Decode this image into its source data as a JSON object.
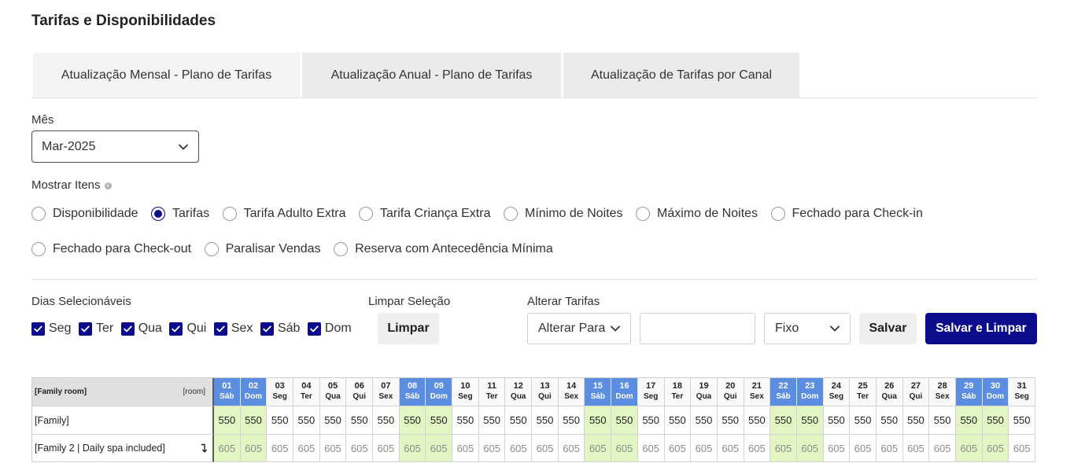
{
  "page_title": "Tarifas e Disponibilidades",
  "tabs": [
    {
      "label": "Atualização Mensal - Plano de Tarifas",
      "active": true
    },
    {
      "label": "Atualização Anual - Plano de Tarifas",
      "active": false
    },
    {
      "label": "Atualização de Tarifas por Canal",
      "active": false
    }
  ],
  "month": {
    "label": "Mês",
    "value": "Mar-2025"
  },
  "show_items": {
    "label": "Mostrar Itens",
    "info_icon": "info-icon",
    "options": [
      {
        "label": "Disponibilidade",
        "checked": false
      },
      {
        "label": "Tarifas",
        "checked": true
      },
      {
        "label": "Tarifa Adulto Extra",
        "checked": false
      },
      {
        "label": "Tarifa Criança Extra",
        "checked": false
      },
      {
        "label": "Mínimo de Noites",
        "checked": false
      },
      {
        "label": "Máximo de Noites",
        "checked": false
      },
      {
        "label": "Fechado para Check-in",
        "checked": false
      },
      {
        "label": "Fechado para Check-out",
        "checked": false
      },
      {
        "label": "Paralisar Vendas",
        "checked": false
      },
      {
        "label": "Reserva com Antecedência Mínima",
        "checked": false
      }
    ]
  },
  "selectable_days": {
    "label": "Dias Selecionáveis",
    "days": [
      {
        "label": "Seg",
        "checked": true
      },
      {
        "label": "Ter",
        "checked": true
      },
      {
        "label": "Qua",
        "checked": true
      },
      {
        "label": "Qui",
        "checked": true
      },
      {
        "label": "Sex",
        "checked": true
      },
      {
        "label": "Sáb",
        "checked": true
      },
      {
        "label": "Dom",
        "checked": true
      }
    ]
  },
  "clear_selection": {
    "label": "Limpar Seleção",
    "button": "Limpar"
  },
  "change_rates": {
    "label": "Alterar Tarifas",
    "mode": "Alterar Para",
    "amount": "",
    "type": "Fixo",
    "save": "Salvar",
    "save_and_clear": "Salvar e Limpar"
  },
  "rate_grid": {
    "room_type": "[Family room]",
    "room_type_tag": "[room]",
    "dates": [
      {
        "day": "01",
        "weekday": "Sáb"
      },
      {
        "day": "02",
        "weekday": "Dom"
      },
      {
        "day": "03",
        "weekday": "Seg"
      },
      {
        "day": "04",
        "weekday": "Ter"
      },
      {
        "day": "05",
        "weekday": "Qua"
      },
      {
        "day": "06",
        "weekday": "Qui"
      },
      {
        "day": "07",
        "weekday": "Sex"
      },
      {
        "day": "08",
        "weekday": "Sáb"
      },
      {
        "day": "09",
        "weekday": "Dom"
      },
      {
        "day": "10",
        "weekday": "Seg"
      },
      {
        "day": "11",
        "weekday": "Ter"
      },
      {
        "day": "12",
        "weekday": "Qua"
      },
      {
        "day": "13",
        "weekday": "Qui"
      },
      {
        "day": "14",
        "weekday": "Sex"
      },
      {
        "day": "15",
        "weekday": "Sáb"
      },
      {
        "day": "16",
        "weekday": "Dom"
      },
      {
        "day": "17",
        "weekday": "Seg"
      },
      {
        "day": "18",
        "weekday": "Ter"
      },
      {
        "day": "19",
        "weekday": "Qua"
      },
      {
        "day": "20",
        "weekday": "Qui"
      },
      {
        "day": "21",
        "weekday": "Sex"
      },
      {
        "day": "22",
        "weekday": "Sáb"
      },
      {
        "day": "23",
        "weekday": "Dom"
      },
      {
        "day": "24",
        "weekday": "Seg"
      },
      {
        "day": "25",
        "weekday": "Ter"
      },
      {
        "day": "26",
        "weekday": "Qua"
      },
      {
        "day": "27",
        "weekday": "Qui"
      },
      {
        "day": "28",
        "weekday": "Sex"
      },
      {
        "day": "29",
        "weekday": "Sáb"
      },
      {
        "day": "30",
        "weekday": "Dom"
      },
      {
        "day": "31",
        "weekday": "Seg"
      }
    ],
    "rows": [
      {
        "name": "[Family]",
        "muted": false,
        "values": [
          550,
          550,
          550,
          550,
          550,
          550,
          550,
          550,
          550,
          550,
          550,
          550,
          550,
          550,
          550,
          550,
          550,
          550,
          550,
          550,
          550,
          550,
          550,
          550,
          550,
          550,
          550,
          550,
          550,
          550,
          550
        ]
      },
      {
        "name": "[Family 2 | Daily spa included]",
        "muted": true,
        "icon": "level-down-icon",
        "values": [
          605,
          605,
          605,
          605,
          605,
          605,
          605,
          605,
          605,
          605,
          605,
          605,
          605,
          605,
          605,
          605,
          605,
          605,
          605,
          605,
          605,
          605,
          605,
          605,
          605,
          605,
          605,
          605,
          605,
          605,
          605
        ]
      }
    ]
  },
  "colors": {
    "primary": "#0b0b8c",
    "weekend_header": "#5b8ee1",
    "weekend_cell": "#e2f6c4",
    "muted_text": "#8c8c8c"
  }
}
